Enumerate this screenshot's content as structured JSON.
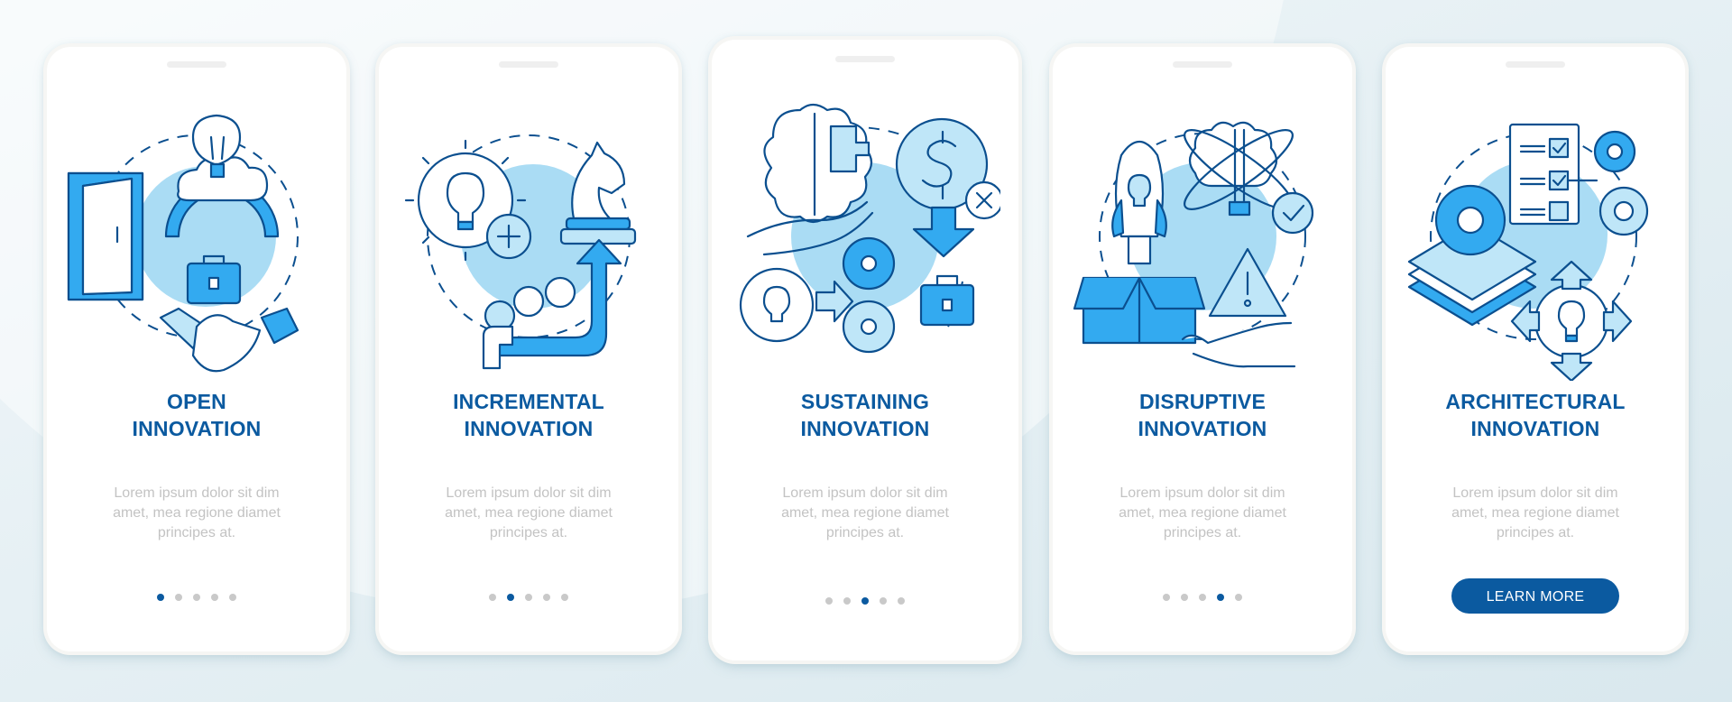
{
  "theme": {
    "accent": "#0b5aa0",
    "illustration_fill": "#33aaf0",
    "illustration_light": "#aadcf4",
    "muted_text": "#c3c3c3",
    "inactive_dot": "#c9c9c9"
  },
  "screens": [
    {
      "title_line1": "OPEN",
      "title_line2": "INNOVATION",
      "description": "Lorem ipsum dolor sit dim amet, mea regione diamet principes at.",
      "illustration_icons": [
        "open-door-icon",
        "lightbulb-cloud-icon",
        "rainbow-icon",
        "briefcase-icon",
        "handshake-icon"
      ],
      "pagination": {
        "total": 5,
        "current": 1
      }
    },
    {
      "title_line1": "INCREMENTAL",
      "title_line2": "INNOVATION",
      "description": "Lorem ipsum dolor sit dim amet, mea regione diamet principes at.",
      "illustration_icons": [
        "gear-lightbulb-icon",
        "plus-circle-icon",
        "chess-knight-icon",
        "team-icon",
        "growth-arrow-icon"
      ],
      "pagination": {
        "total": 5,
        "current": 2
      }
    },
    {
      "title_line1": "SUSTAINING",
      "title_line2": "INNOVATION",
      "description": "Lorem ipsum dolor sit dim amet, mea regione diamet principes at.",
      "illustration_icons": [
        "brain-puzzle-icon",
        "hand-icon",
        "dollar-circle-icon",
        "x-circle-icon",
        "down-arrow-icon",
        "briefcase-icon",
        "gear-lightbulb-icon",
        "gears-icon"
      ],
      "pagination": {
        "total": 5,
        "current": 3
      }
    },
    {
      "title_line1": "DISRUPTIVE",
      "title_line2": "INNOVATION",
      "description": "Lorem ipsum dolor sit dim amet, mea regione diamet principes at.",
      "illustration_icons": [
        "rocket-icon",
        "box-icon",
        "brain-bulb-atom-icon",
        "check-circle-icon",
        "warning-triangle-icon",
        "hand-icon"
      ],
      "pagination": {
        "total": 5,
        "current": 4
      }
    },
    {
      "title_line1": "ARCHITECTURAL",
      "title_line2": "INNOVATION",
      "description": "Lorem ipsum dolor sit dim amet, mea regione diamet principes at.",
      "illustration_icons": [
        "checklist-icon",
        "gears-icon",
        "layers-gear-icon",
        "gear-lightbulb-arrows-icon"
      ],
      "button_label": "LEARN MORE"
    }
  ]
}
